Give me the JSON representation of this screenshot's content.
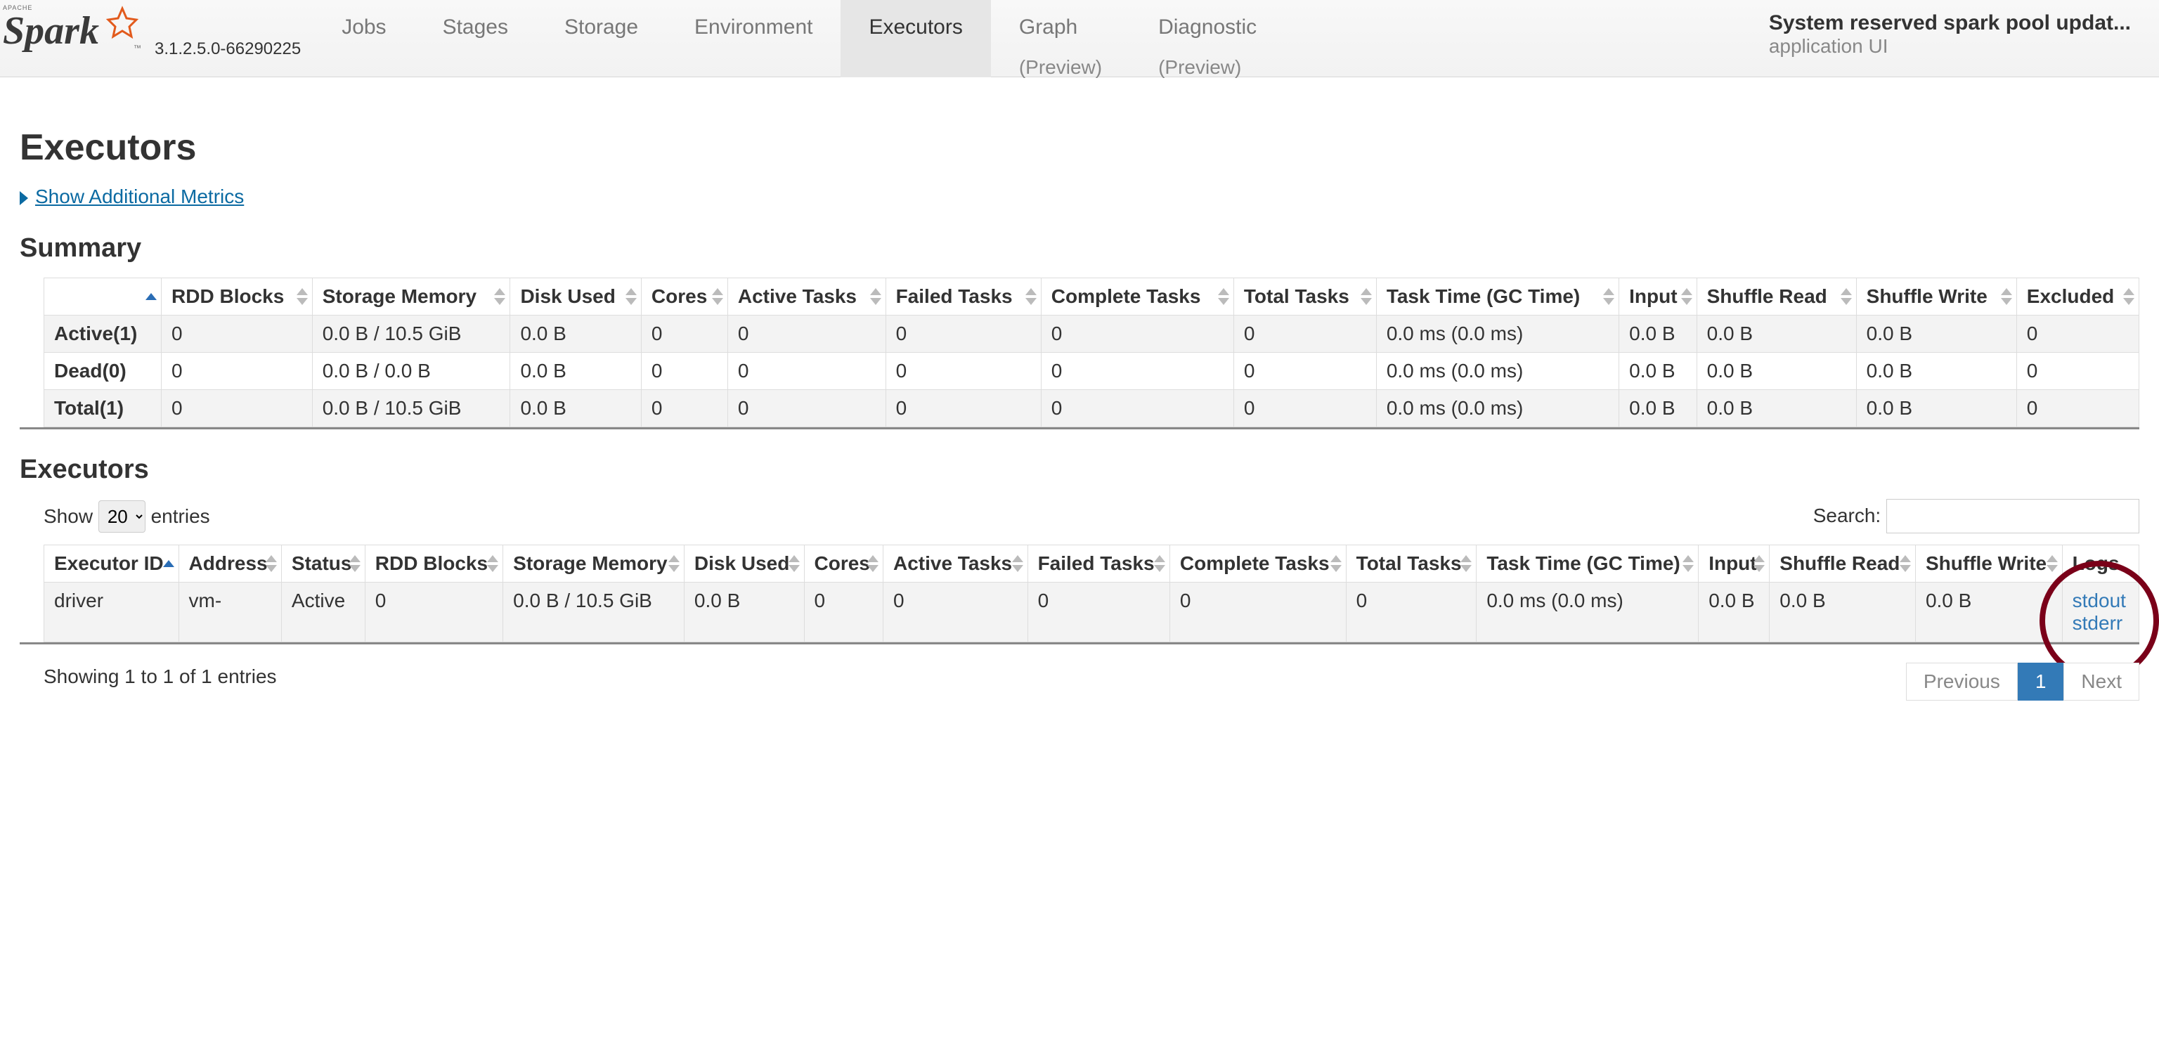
{
  "nav": {
    "version": "3.1.2.5.0-66290225",
    "tabs": [
      {
        "label": "Jobs",
        "preview": ""
      },
      {
        "label": "Stages",
        "preview": ""
      },
      {
        "label": "Storage",
        "preview": ""
      },
      {
        "label": "Environment",
        "preview": ""
      },
      {
        "label": "Executors",
        "preview": "",
        "active": true
      },
      {
        "label": "Graph",
        "preview": "(Preview)"
      },
      {
        "label": "Diagnostic",
        "preview": "(Preview)"
      }
    ],
    "app_title": "System reserved spark pool updat...",
    "app_subtitle": "application UI"
  },
  "page_title": "Executors",
  "toggle_label": "Show Additional Metrics",
  "summary": {
    "heading": "Summary",
    "columns": [
      "",
      "RDD Blocks",
      "Storage Memory",
      "Disk Used",
      "Cores",
      "Active Tasks",
      "Failed Tasks",
      "Complete Tasks",
      "Total Tasks",
      "Task Time (GC Time)",
      "Input",
      "Shuffle Read",
      "Shuffle Write",
      "Excluded"
    ],
    "rows": [
      {
        "label": "Active(1)",
        "cells": [
          "0",
          "0.0 B / 10.5 GiB",
          "0.0 B",
          "0",
          "0",
          "0",
          "0",
          "0",
          "0.0 ms (0.0 ms)",
          "0.0 B",
          "0.0 B",
          "0.0 B",
          "0"
        ]
      },
      {
        "label": "Dead(0)",
        "cells": [
          "0",
          "0.0 B / 0.0 B",
          "0.0 B",
          "0",
          "0",
          "0",
          "0",
          "0",
          "0.0 ms (0.0 ms)",
          "0.0 B",
          "0.0 B",
          "0.0 B",
          "0"
        ]
      },
      {
        "label": "Total(1)",
        "cells": [
          "0",
          "0.0 B / 10.5 GiB",
          "0.0 B",
          "0",
          "0",
          "0",
          "0",
          "0",
          "0.0 ms (0.0 ms)",
          "0.0 B",
          "0.0 B",
          "0.0 B",
          "0"
        ]
      }
    ]
  },
  "executors": {
    "heading": "Executors",
    "length_prefix": "Show",
    "length_value": "20",
    "length_suffix": "entries",
    "search_label": "Search:",
    "columns": [
      "Executor ID",
      "Address",
      "Status",
      "RDD Blocks",
      "Storage Memory",
      "Disk Used",
      "Cores",
      "Active Tasks",
      "Failed Tasks",
      "Complete Tasks",
      "Total Tasks",
      "Task Time (GC Time)",
      "Input",
      "Shuffle Read",
      "Shuffle Write",
      "Logs"
    ],
    "rows": [
      {
        "id": "driver",
        "address": "vm-",
        "status": "Active",
        "rdd": "0",
        "stor": "0.0 B / 10.5 GiB",
        "disk": "0.0 B",
        "cores": "0",
        "at": "0",
        "ft": "0",
        "ct": "0",
        "tt": "0",
        "ttgc": "0.0 ms (0.0 ms)",
        "input": "0.0 B",
        "sr": "0.0 B",
        "sw": "0.0 B",
        "log1": "stdout",
        "log2": "stderr"
      }
    ],
    "info": "Showing 1 to 1 of 1 entries",
    "prev": "Previous",
    "page": "1",
    "next": "Next"
  }
}
